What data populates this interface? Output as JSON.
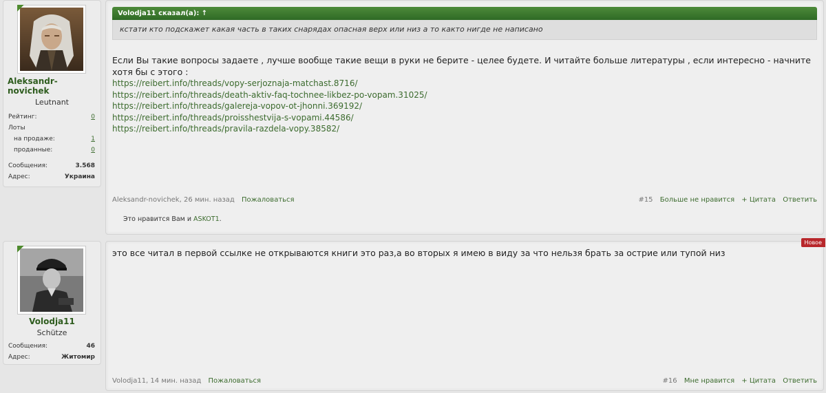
{
  "posts": [
    {
      "author": {
        "name": "Aleksandr-novichek",
        "rank": "Leutnant",
        "stats": {
          "rating_label": "Рейтинг:",
          "rating_value": "0",
          "lots_label": "Лоты",
          "on_sale_label": "на продаже:",
          "on_sale_value": "1",
          "sold_label": "проданные:",
          "sold_value": "0",
          "messages_label": "Сообщения:",
          "messages_value": "3.568",
          "address_label": "Адрес:",
          "address_value": "Украина"
        }
      },
      "quote": {
        "header": "Volodja11 сказал(а): ↑",
        "text": "кстати кто подскажет какая часть в таких снарядах опасная верх или низ а то както нигде не написано"
      },
      "body": "Если Вы такие вопросы задаете , лучше вообще такие вещи в руки не берите - целее будете. И читайте больше литературы , если интересно - начните хотя бы с этого :",
      "links": [
        "https://reibert.info/threads/vopy-serjoznaja-matchast.8716/",
        "https://reibert.info/threads/death-aktiv-faq-tochnee-likbez-po-vopam.31025/",
        "https://reibert.info/threads/galereja-vopov-ot-jhonni.369192/",
        "https://reibert.info/threads/proisshestvija-s-vopami.44586/",
        "https://reibert.info/threads/pravila-razdela-vopy.38582/"
      ],
      "footer": {
        "meta": "Aleksandr-novichek, 26 мин. назад",
        "report": "Пожаловаться",
        "post_number": "#15",
        "like_action": "Больше не нравится",
        "quote_action": "+ Цитата",
        "reply_action": "Ответить"
      },
      "likes": {
        "prefix": "Это нравится Вам и ",
        "user": "ASKOT1",
        "suffix": "."
      }
    },
    {
      "author": {
        "name": "Volodja11",
        "rank": "Schütze",
        "stats": {
          "messages_label": "Сообщения:",
          "messages_value": "46",
          "address_label": "Адрес:",
          "address_value": "Житомир"
        }
      },
      "badge": "Новое",
      "body": "это все читал в первой ссылке не открываются книги это раз,а во вторых я имею в виду за что нельзя брать за острие или тупой низ",
      "footer": {
        "meta": "Volodja11, 14 мин. назад",
        "report": "Пожаловаться",
        "post_number": "#16",
        "like_action": "Мне нравится",
        "quote_action": "+ Цитата",
        "reply_action": "Ответить"
      }
    }
  ]
}
